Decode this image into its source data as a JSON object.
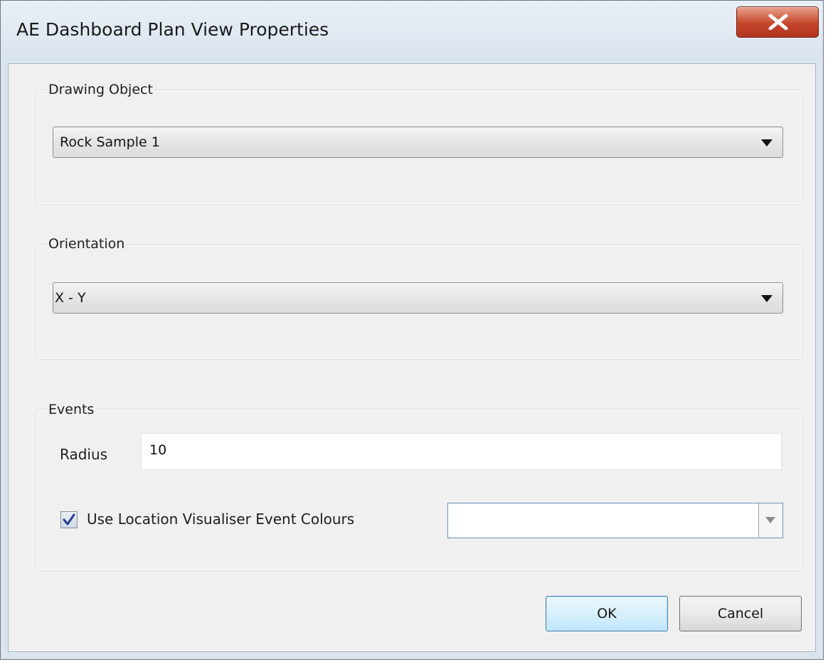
{
  "window": {
    "title": "AE Dashboard Plan View Properties",
    "close_icon": "close-x-icon"
  },
  "drawing_object": {
    "group_label": "Drawing Object",
    "selected": "Rock Sample 1"
  },
  "orientation": {
    "group_label": "Orientation",
    "selected": "X - Y"
  },
  "events": {
    "group_label": "Events",
    "radius_label": "Radius",
    "radius_value": "10",
    "use_colours_label": "Use Location Visualiser Event Colours",
    "use_colours_checked": true,
    "colour_value": ""
  },
  "buttons": {
    "ok": "OK",
    "cancel": "Cancel"
  },
  "colors": {
    "close_button": "#c4452b",
    "ok_border": "#3c7fb1",
    "focus_border": "#6b8fb8"
  }
}
